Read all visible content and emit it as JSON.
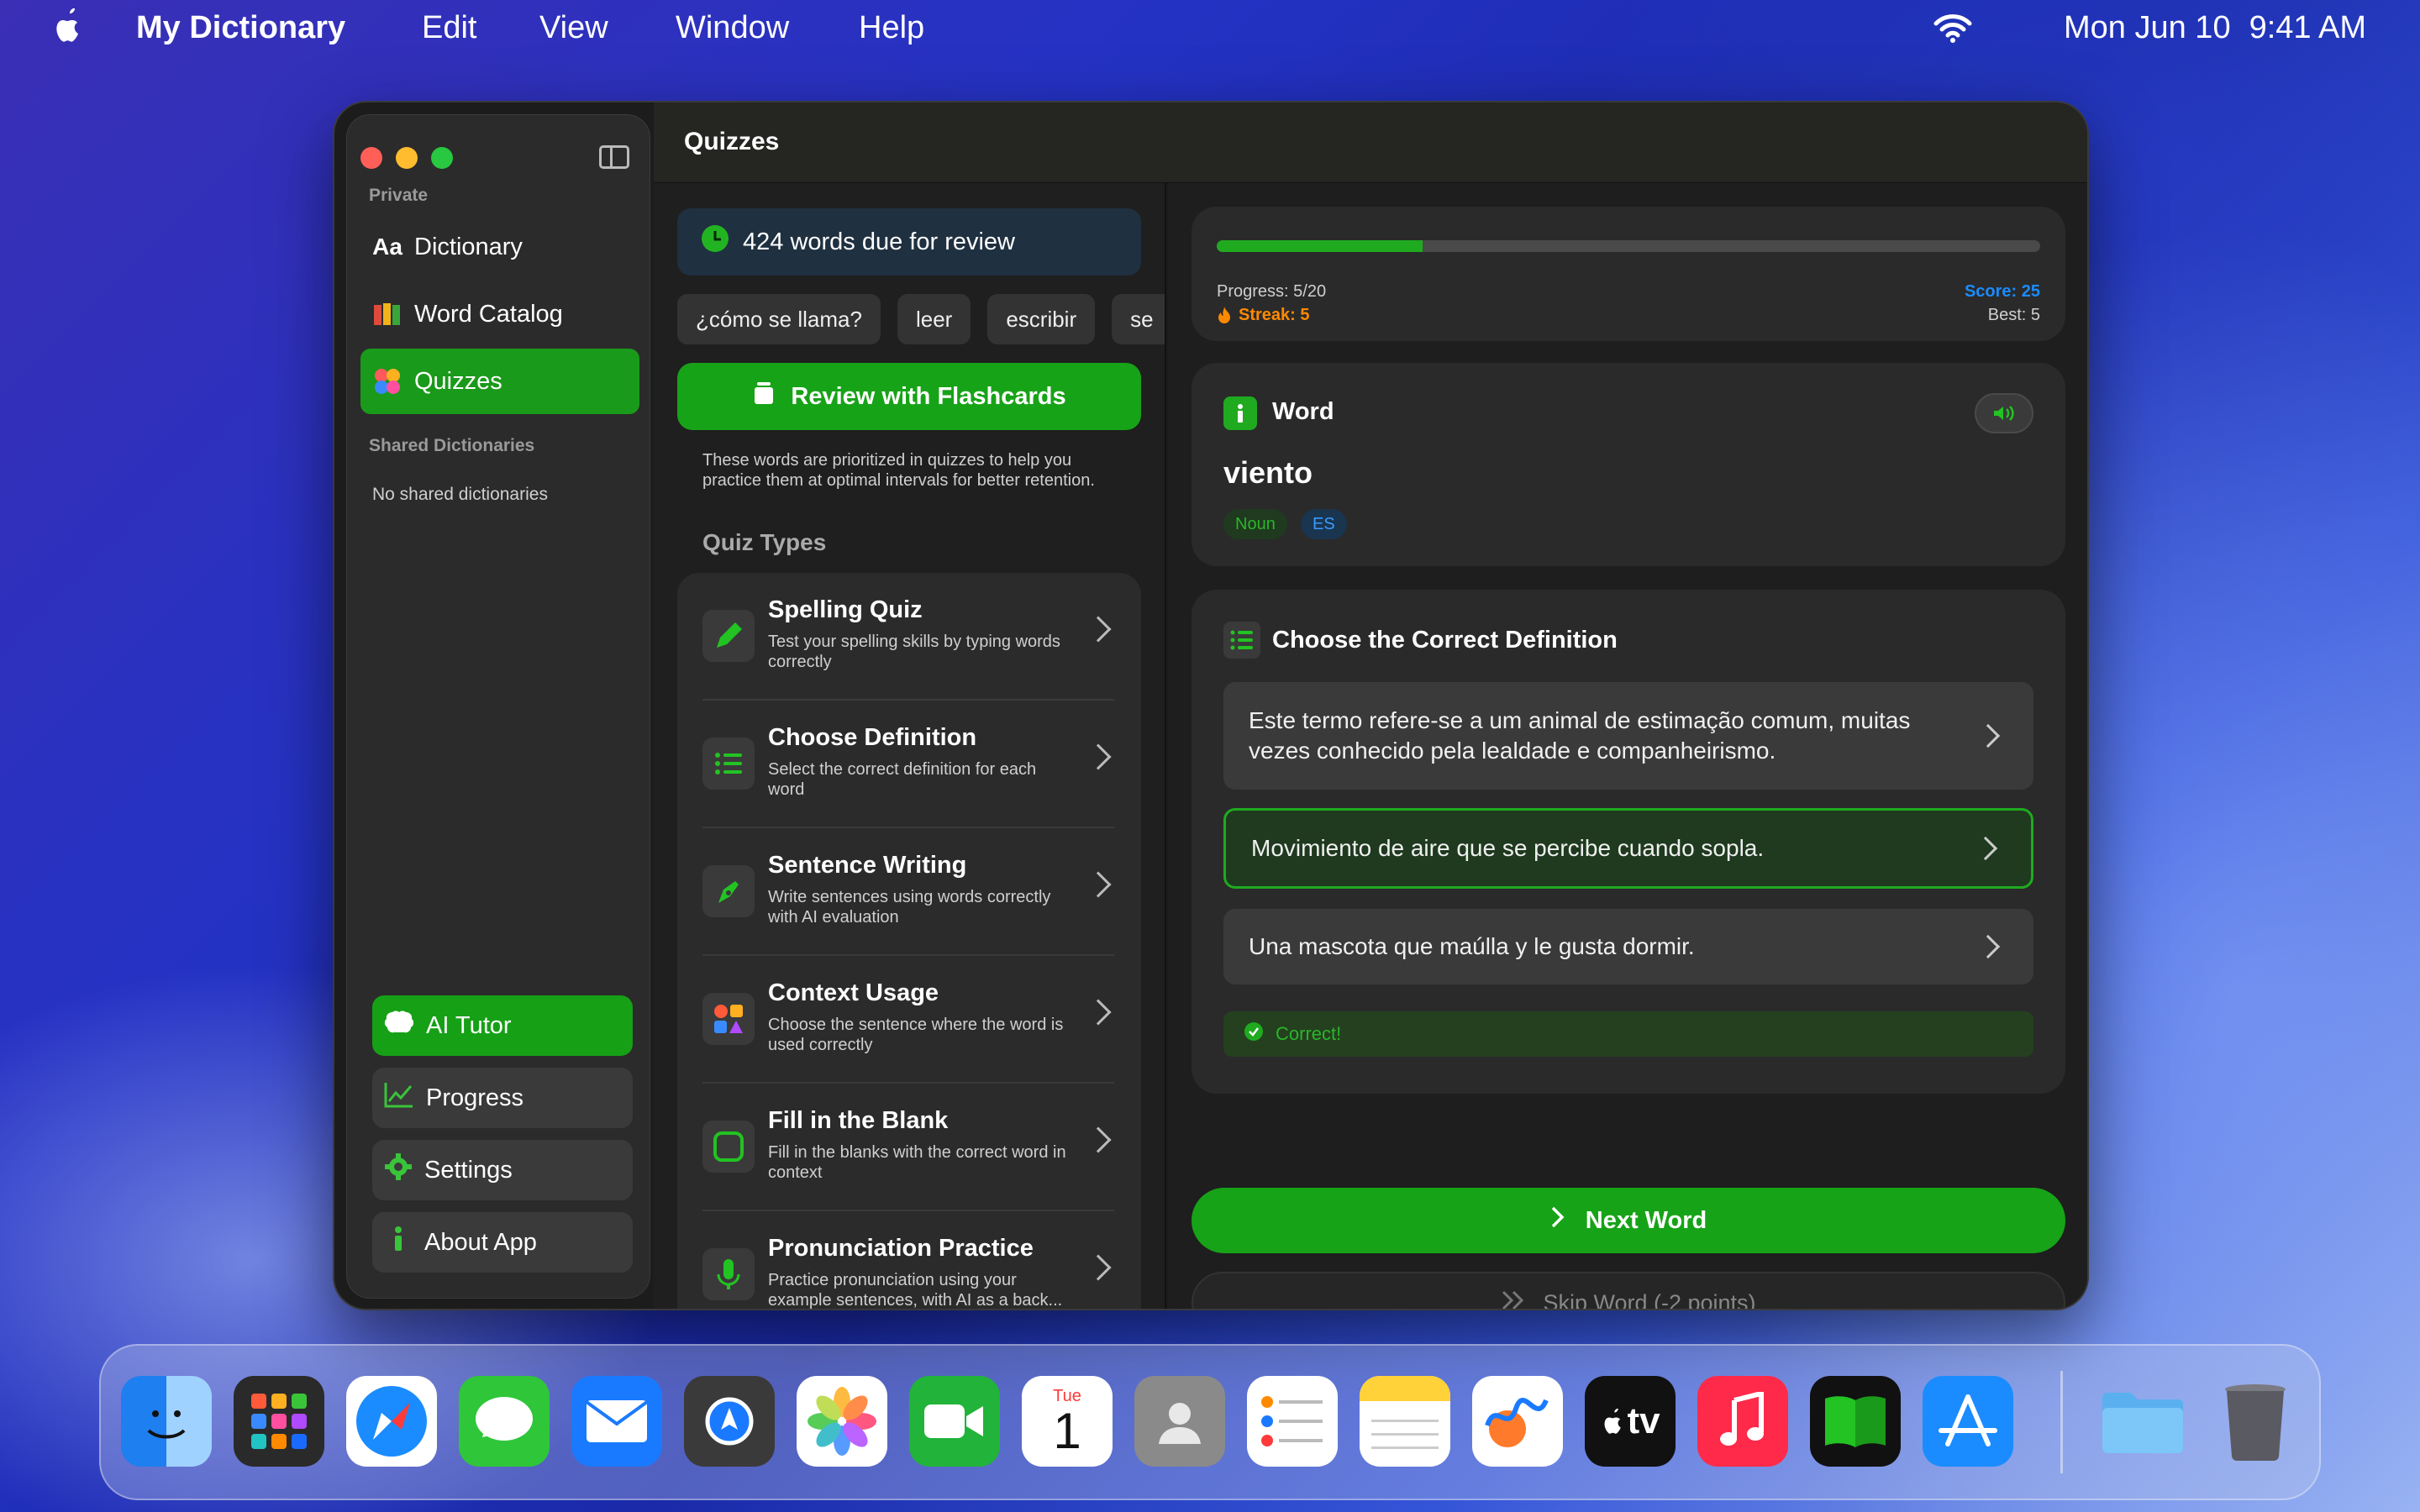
{
  "menubar": {
    "app_name": "My Dictionary",
    "items": [
      "Edit",
      "View",
      "Window",
      "Help"
    ],
    "date": "Mon Jun 10",
    "time": "9:41 AM"
  },
  "window": {
    "title": "Quizzes"
  },
  "sidebar": {
    "section_private": "Private",
    "items": [
      {
        "icon": "Aa",
        "label": "Dictionary"
      },
      {
        "icon": "catalog-icon",
        "label": "Word Catalog"
      },
      {
        "icon": "quiz-icon",
        "label": "Quizzes"
      }
    ],
    "section_shared": "Shared Dictionaries",
    "shared_empty": "No shared dictionaries",
    "bottom": [
      {
        "icon": "brain-icon",
        "label": "AI Tutor"
      },
      {
        "icon": "chart-icon",
        "label": "Progress"
      },
      {
        "icon": "gear-icon",
        "label": "Settings"
      },
      {
        "icon": "info-icon",
        "label": "About App"
      }
    ]
  },
  "review": {
    "due_text": "424 words due for review",
    "chips": [
      "¿cómo se llama?",
      "leer",
      "escribir",
      "se"
    ],
    "button": "Review with Flashcards",
    "hint": "These words are prioritized in quizzes to help you practice them at optimal intervals for better retention."
  },
  "quiz_types": {
    "heading": "Quiz Types",
    "items": [
      {
        "title": "Spelling Quiz",
        "desc": "Test your spelling skills by typing words correctly"
      },
      {
        "title": "Choose Definition",
        "desc": "Select the correct definition for each word"
      },
      {
        "title": "Sentence Writing",
        "desc": "Write sentences using words correctly with AI evaluation"
      },
      {
        "title": "Context Usage",
        "desc": "Choose the sentence where the word is used correctly"
      },
      {
        "title": "Fill in the Blank",
        "desc": "Fill in the blanks with the correct word in context"
      },
      {
        "title": "Pronunciation Practice",
        "desc": "Practice pronunciation using your example sentences, with AI as a back..."
      }
    ]
  },
  "quiz": {
    "progress_label": "Progress: 5/20",
    "progress_fraction": 0.25,
    "streak_label": "Streak: 5",
    "score_label": "Score: 25",
    "best_label": "Best: 5",
    "word_header": "Word",
    "word": "viento",
    "tags": [
      "Noun",
      "ES"
    ],
    "question_title": "Choose the Correct Definition",
    "options": [
      "Este termo refere-se a um animal de estimação comum, muitas vezes conhecido pela lealdade e companheirismo.",
      "Movimiento de aire que se percibe cuando sopla.",
      "Una mascota que maúlla y le gusta dormir."
    ],
    "selected_index": 1,
    "feedback": "Correct!",
    "next_button": "Next Word",
    "skip_button": "Skip Word (-2 points)"
  },
  "dock": {
    "calendar_month": "Tue",
    "calendar_day": "1",
    "tv_label": "tv",
    "apps": [
      "finder-icon",
      "launchpad-icon",
      "safari-icon",
      "messages-icon",
      "mail-icon",
      "maps-icon",
      "photos-icon",
      "facetime-icon",
      "calendar-icon",
      "contacts-icon",
      "reminders-icon",
      "notes-icon",
      "freeform-icon",
      "tv-icon",
      "music-icon",
      "my-dictionary-icon",
      "app-store-icon",
      "folder-icon",
      "trash-icon"
    ]
  },
  "colors": {
    "accent_green": "#17a317",
    "score_blue": "#1a8cff",
    "streak_orange": "#ff8a00"
  }
}
